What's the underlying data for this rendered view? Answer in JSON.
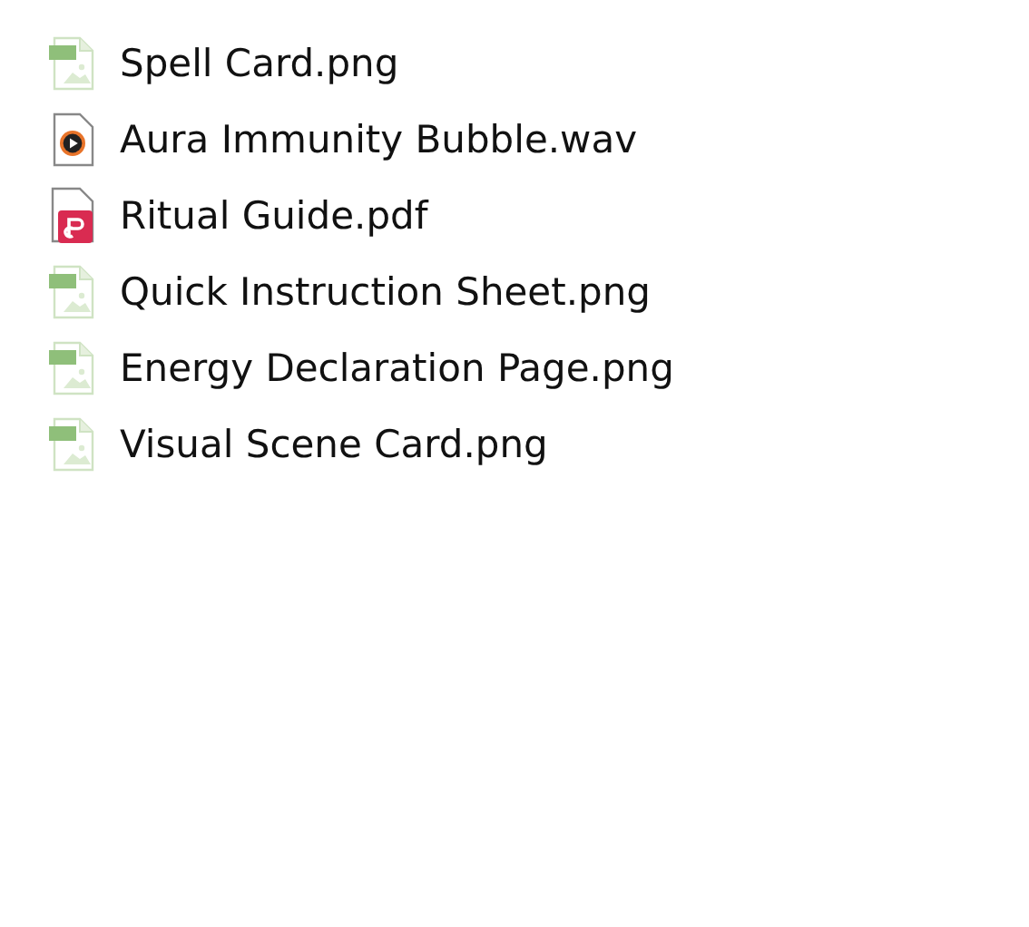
{
  "files": [
    {
      "name": "Spell Card.png",
      "kind": "png"
    },
    {
      "name": "Aura Immunity Bubble.wav",
      "kind": "wav"
    },
    {
      "name": "Ritual Guide.pdf",
      "kind": "pdf"
    },
    {
      "name": "Quick Instruction Sheet.png",
      "kind": "png"
    },
    {
      "name": "Energy Declaration Page.png",
      "kind": "png"
    },
    {
      "name": "Visual Scene Card.png",
      "kind": "png"
    }
  ]
}
